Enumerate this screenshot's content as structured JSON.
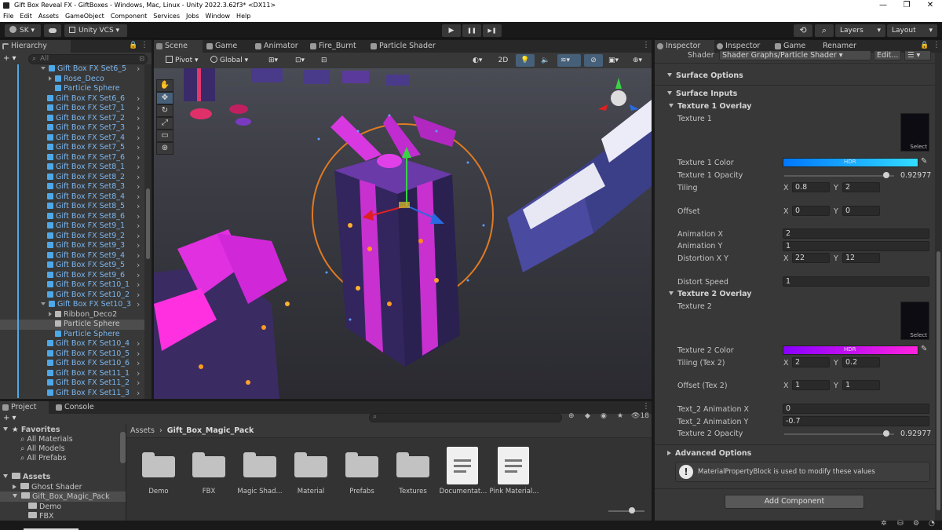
{
  "window": {
    "title": "Gift Box Reveal FX - GiftBoxes - Windows, Mac, Linux - Unity 2022.3.62f3* <DX11>",
    "min_icon": "minimize-icon",
    "max_icon": "maximize-icon",
    "close_icon": "close-icon",
    "min_glyph": "—",
    "max_glyph": "❐",
    "close_glyph": "✕"
  },
  "menu": [
    "File",
    "Edit",
    "Assets",
    "GameObject",
    "Component",
    "Services",
    "Jobs",
    "Window",
    "Help"
  ],
  "toolbar": {
    "account": "SK ▾",
    "cloud_icon": "cloud-icon",
    "vcs": "Unity VCS ▾",
    "play_glyph": "▶",
    "pause_glyph": "❚❚",
    "step_glyph": "▶❚",
    "layers": "Layers",
    "layout": "Layout",
    "history_glyph": "⟲",
    "search_glyph": "⌕"
  },
  "hierarchy": {
    "tab": "Hierarchy",
    "add": "+ ▾",
    "search_placeholder": "All",
    "rows": [
      {
        "label": "Gift Box FX Set6_5",
        "kind": "prefab-open",
        "indent": 0,
        "blue": true
      },
      {
        "label": "Rose_Deco",
        "kind": "child-prefab",
        "indent": 1,
        "blue": true
      },
      {
        "label": "Particle Sphere",
        "kind": "child",
        "indent": 1,
        "blue": true
      },
      {
        "label": "Gift Box FX Set6_6",
        "kind": "prefab",
        "indent": 0,
        "blue": true
      },
      {
        "label": "Gift Box FX Set7_1",
        "kind": "prefab",
        "indent": 0,
        "blue": true
      },
      {
        "label": "Gift Box FX Set7_2",
        "kind": "prefab",
        "indent": 0,
        "blue": true
      },
      {
        "label": "Gift Box FX Set7_3",
        "kind": "prefab",
        "indent": 0,
        "blue": true
      },
      {
        "label": "Gift Box FX Set7_4",
        "kind": "prefab",
        "indent": 0,
        "blue": true
      },
      {
        "label": "Gift Box FX Set7_5",
        "kind": "prefab",
        "indent": 0,
        "blue": true
      },
      {
        "label": "Gift Box FX Set7_6",
        "kind": "prefab",
        "indent": 0,
        "blue": true
      },
      {
        "label": "Gift Box FX Set8_1",
        "kind": "prefab",
        "indent": 0,
        "blue": true
      },
      {
        "label": "Gift Box FX Set8_2",
        "kind": "prefab",
        "indent": 0,
        "blue": true
      },
      {
        "label": "Gift Box FX Set8_3",
        "kind": "prefab",
        "indent": 0,
        "blue": true
      },
      {
        "label": "Gift Box FX Set8_4",
        "kind": "prefab",
        "indent": 0,
        "blue": true
      },
      {
        "label": "Gift Box FX Set8_5",
        "kind": "prefab",
        "indent": 0,
        "blue": true
      },
      {
        "label": "Gift Box FX Set8_6",
        "kind": "prefab",
        "indent": 0,
        "blue": true
      },
      {
        "label": "Gift Box FX Set9_1",
        "kind": "prefab",
        "indent": 0,
        "blue": true
      },
      {
        "label": "Gift Box FX Set9_2",
        "kind": "prefab",
        "indent": 0,
        "blue": true
      },
      {
        "label": "Gift Box FX Set9_3",
        "kind": "prefab",
        "indent": 0,
        "blue": true
      },
      {
        "label": "Gift Box FX Set9_4",
        "kind": "prefab",
        "indent": 0,
        "blue": true
      },
      {
        "label": "Gift Box FX Set9_5",
        "kind": "prefab",
        "indent": 0,
        "blue": true
      },
      {
        "label": "Gift Box FX Set9_6",
        "kind": "prefab",
        "indent": 0,
        "blue": true
      },
      {
        "label": "Gift Box FX Set10_1",
        "kind": "prefab",
        "indent": 0,
        "blue": true
      },
      {
        "label": "Gift Box FX Set10_2",
        "kind": "prefab",
        "indent": 0,
        "blue": true
      },
      {
        "label": "Gift Box FX Set10_3",
        "kind": "prefab-open",
        "indent": 0,
        "blue": true
      },
      {
        "label": "Ribbon_Deco2",
        "kind": "child-prefab",
        "indent": 1,
        "blue": false
      },
      {
        "label": "Particle Sphere",
        "kind": "child-selected",
        "indent": 1,
        "blue": false
      },
      {
        "label": "Particle Sphere",
        "kind": "child",
        "indent": 1,
        "blue": true
      },
      {
        "label": "Gift Box FX Set10_4",
        "kind": "prefab",
        "indent": 0,
        "blue": true
      },
      {
        "label": "Gift Box FX Set10_5",
        "kind": "prefab",
        "indent": 0,
        "blue": true
      },
      {
        "label": "Gift Box FX Set10_6",
        "kind": "prefab",
        "indent": 0,
        "blue": true
      },
      {
        "label": "Gift Box FX Set11_1",
        "kind": "prefab",
        "indent": 0,
        "blue": true
      },
      {
        "label": "Gift Box FX Set11_2",
        "kind": "prefab",
        "indent": 0,
        "blue": true
      },
      {
        "label": "Gift Box FX Set11_3",
        "kind": "prefab",
        "indent": 0,
        "blue": true
      }
    ]
  },
  "scene_tabs": [
    {
      "label": "Scene",
      "active": true
    },
    {
      "label": "Game",
      "active": false
    },
    {
      "label": "Animator",
      "active": false
    },
    {
      "label": "Fire_Burnt",
      "active": false
    },
    {
      "label": "Particle Shader",
      "active": false
    }
  ],
  "scene_toolbar": {
    "pivot": "Pivot ▾",
    "global": "Global ▾",
    "twod": "2D"
  },
  "inspector": {
    "tabs": [
      "Inspector",
      "Inspector",
      "Game",
      "Renamer"
    ],
    "shader_label": "Shader",
    "shader_value": "Shader Graphs/Particle Shader ▾",
    "edit_button": "Edit...",
    "sections": {
      "surface_options": "Surface Options",
      "surface_inputs": "Surface Inputs",
      "texture1_overlay": "Texture 1 Overlay",
      "texture2_overlay": "Texture 2 Overlay",
      "advanced": "Advanced Options"
    },
    "select_label": "Select",
    "hdr_label": "HDR",
    "props": {
      "texture1": "Texture 1",
      "texture1_color": "Texture 1 Color",
      "texture1_opacity": "Texture 1 Opacity",
      "texture1_opacity_value": "0.92977",
      "tiling": "Tiling",
      "tiling_x": "0.8",
      "tiling_y": "2",
      "offset": "Offset",
      "offset_x": "0",
      "offset_y": "0",
      "animation_x": "Animation X",
      "animation_x_value": "2",
      "animation_y": "Animation Y",
      "animation_y_value": "1",
      "distortion_xy": "Distortion X Y",
      "distortion_x": "22",
      "distortion_y": "12",
      "distort_speed": "Distort Speed",
      "distort_speed_value": "1",
      "texture2": "Texture 2",
      "texture2_color": "Texture 2 Color",
      "tiling2": "Tiling (Tex 2)",
      "tiling2_x": "2",
      "tiling2_y": "0.2",
      "offset2": "Offset (Tex 2)",
      "offset2_x": "1",
      "offset2_y": "1",
      "t2_anim_x": "Text_2 Animation X",
      "t2_anim_x_value": "0",
      "t2_anim_y": "Text_2 Animation Y",
      "t2_anim_y_value": "-0.7",
      "texture2_opacity": "Texture 2 Opacity",
      "texture2_opacity_value": "0.92977"
    },
    "x_label": "X",
    "y_label": "Y",
    "opacity1_fraction": 0.93,
    "opacity2_fraction": 0.93,
    "info_message": "MaterialPropertyBlock is used to modify these values",
    "add_component": "Add Component"
  },
  "project": {
    "tabs": [
      "Project",
      "Console"
    ],
    "add": "+ ▾",
    "favorites": "Favorites",
    "fav_items": [
      "All Materials",
      "All Models",
      "All Prefabs"
    ],
    "assets": "Assets",
    "tree": [
      "Ghost Shader",
      "Gift_Box_Magic_Pack",
      "Demo",
      "FBX"
    ],
    "breadcrumb_root": "Assets",
    "breadcrumb_sep": "›",
    "breadcrumb_current": "Gift_Box_Magic_Pack",
    "hidden_count": "18",
    "items": [
      {
        "label": "Demo",
        "type": "folder"
      },
      {
        "label": "FBX",
        "type": "folder"
      },
      {
        "label": "Magic Shad...",
        "type": "folder"
      },
      {
        "label": "Material",
        "type": "folder"
      },
      {
        "label": "Prefabs",
        "type": "folder"
      },
      {
        "label": "Textures",
        "type": "folder"
      },
      {
        "label": "Documentat...",
        "type": "document"
      },
      {
        "label": "Pink Material...",
        "type": "document"
      }
    ]
  },
  "colors": {
    "accent_blue": "#4ea8e8",
    "selection": "#2c5d87",
    "texture1_gradient_start": "#0077ff",
    "texture1_gradient_end": "#33ddff",
    "texture2_gradient_start": "#8800ff",
    "texture2_gradient_end": "#ff22dd",
    "gizmo_circle": "#e07a22"
  }
}
